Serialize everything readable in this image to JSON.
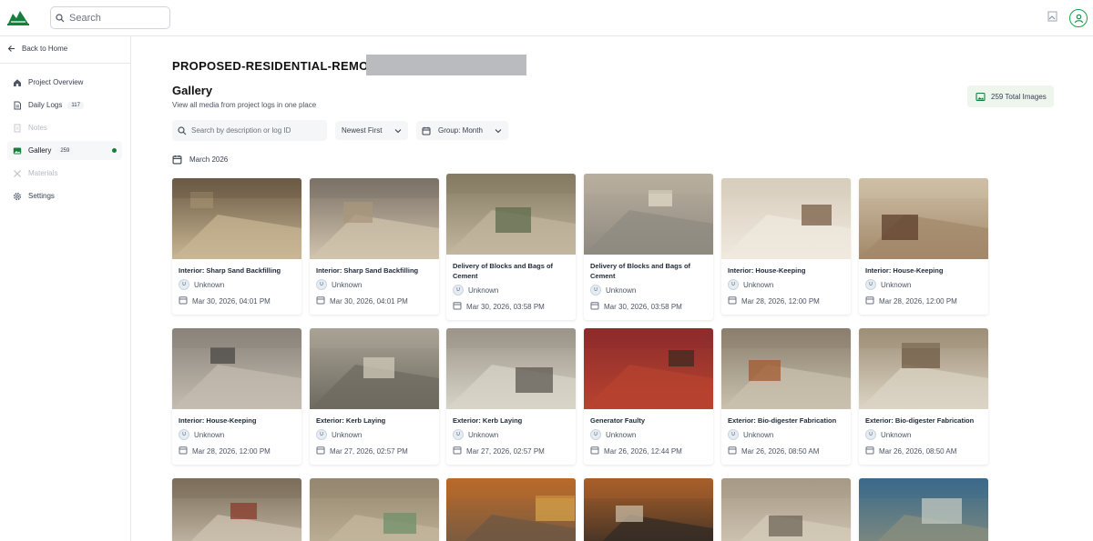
{
  "header": {
    "search_placeholder": "Search",
    "logo_icon": "hills-logo-icon",
    "user_icon": "user-circle-icon",
    "accent": "#16a34a"
  },
  "sidebar": {
    "back_label": "Back to Home",
    "items": [
      {
        "label": "Project Overview",
        "icon": "home-icon",
        "badge": "",
        "state": "normal"
      },
      {
        "label": "Daily Logs",
        "icon": "document-icon",
        "badge": "117",
        "state": "normal"
      },
      {
        "label": "Notes",
        "icon": "note-icon",
        "badge": "",
        "state": "disabled"
      },
      {
        "label": "Gallery",
        "icon": "image-icon",
        "badge": "259",
        "state": "active"
      },
      {
        "label": "Materials",
        "icon": "tools-icon",
        "badge": "",
        "state": "disabled"
      },
      {
        "label": "Settings",
        "icon": "gear-icon",
        "badge": "",
        "state": "normal"
      }
    ]
  },
  "main": {
    "project_title": "PROPOSED-RESIDENTIAL-REMODELI",
    "gallery_title": "Gallery",
    "gallery_subtitle": "View all media from project logs in one place",
    "total_images": "259 Total Images",
    "search_placeholder": "Search by description or log ID",
    "sort_label": "Newest First",
    "group_label": "Group: Month",
    "month_heading": "March 2026"
  },
  "cards": [
    {
      "title": "Interior: Sharp Sand Backfilling",
      "author": "Unknown",
      "avatar": "U",
      "date": "Mar 30, 2026, 04:01 PM",
      "palette": [
        "#6b5a44",
        "#c9b694",
        "#a18d6d"
      ]
    },
    {
      "title": "Interior: Sharp Sand Backfilling",
      "author": "Unknown",
      "avatar": "U",
      "date": "Mar 30, 2026, 04:01 PM",
      "palette": [
        "#7c7268",
        "#d2c4ad",
        "#a8977c"
      ]
    },
    {
      "title": "Delivery of Blocks and Bags of Cement",
      "author": "Unknown",
      "avatar": "U",
      "date": "Mar 30, 2026, 03:58 PM",
      "palette": [
        "#857b63",
        "#c2b79e",
        "#5f6b4e"
      ]
    },
    {
      "title": "Delivery of Blocks and Bags of Cement",
      "author": "Unknown",
      "avatar": "U",
      "date": "Mar 30, 2026, 03:58 PM",
      "palette": [
        "#b8ae9d",
        "#8f8a80",
        "#e0d9c7"
      ]
    },
    {
      "title": "Interior: House-Keeping",
      "author": "Unknown",
      "avatar": "U",
      "date": "Mar 28, 2026, 12:00 PM",
      "palette": [
        "#d8cdbc",
        "#efe9de",
        "#7a5d45"
      ]
    },
    {
      "title": "Interior: House-Keeping",
      "author": "Unknown",
      "avatar": "U",
      "date": "Mar 28, 2026, 12:00 PM",
      "palette": [
        "#cdbfa6",
        "#a3886a",
        "#5e3f2c"
      ]
    },
    {
      "title": "Interior: House-Keeping",
      "author": "Unknown",
      "avatar": "U",
      "date": "Mar 28, 2026, 12:00 PM",
      "palette": [
        "#8a837a",
        "#c4bcb0",
        "#4a4744"
      ]
    },
    {
      "title": "Exterior: Kerb Laying",
      "author": "Unknown",
      "avatar": "U",
      "date": "Mar 27, 2026, 02:57 PM",
      "palette": [
        "#a8a294",
        "#6e6a60",
        "#cfcab8"
      ]
    },
    {
      "title": "Exterior: Kerb Laying",
      "author": "Unknown",
      "avatar": "U",
      "date": "Mar 27, 2026, 02:57 PM",
      "palette": [
        "#9c958a",
        "#d8d4c8",
        "#5d5a52"
      ]
    },
    {
      "title": "Generator Faulty",
      "author": "Unknown",
      "avatar": "U",
      "date": "Mar 26, 2026, 12:44 PM",
      "palette": [
        "#8d2c2c",
        "#b8432f",
        "#3f2a20"
      ]
    },
    {
      "title": "Exterior: Bio-digester Fabrication",
      "author": "Unknown",
      "avatar": "U",
      "date": "Mar 26, 2026, 08:50 AM",
      "palette": [
        "#8b7f6e",
        "#c9c0ae",
        "#a05a2d"
      ]
    },
    {
      "title": "Exterior: Bio-digester Fabrication",
      "author": "Unknown",
      "avatar": "U",
      "date": "Mar 26, 2026, 08:50 AM",
      "palette": [
        "#9e8f77",
        "#dcd4c4",
        "#6d5a43"
      ]
    },
    {
      "title": "",
      "author": "",
      "avatar": "",
      "date": "",
      "palette": [
        "#7b6d5a",
        "#cfc5b2",
        "#8a3b2a"
      ]
    },
    {
      "title": "",
      "author": "",
      "avatar": "",
      "date": "",
      "palette": [
        "#95886f",
        "#c4b89e",
        "#6f8f6a"
      ]
    },
    {
      "title": "",
      "author": "",
      "avatar": "",
      "date": "",
      "palette": [
        "#b86a2b",
        "#6b5744",
        "#d4a24a"
      ]
    },
    {
      "title": "",
      "author": "",
      "avatar": "",
      "date": "",
      "palette": [
        "#a85f2a",
        "#2f2a25",
        "#c7b9a3"
      ]
    },
    {
      "title": "",
      "author": "",
      "avatar": "",
      "date": "",
      "palette": [
        "#a79a86",
        "#d6ccba",
        "#6f655a"
      ]
    },
    {
      "title": "",
      "author": "",
      "avatar": "",
      "date": "",
      "palette": [
        "#3c6a8a",
        "#8a8f7d",
        "#c2c8c0"
      ]
    }
  ]
}
